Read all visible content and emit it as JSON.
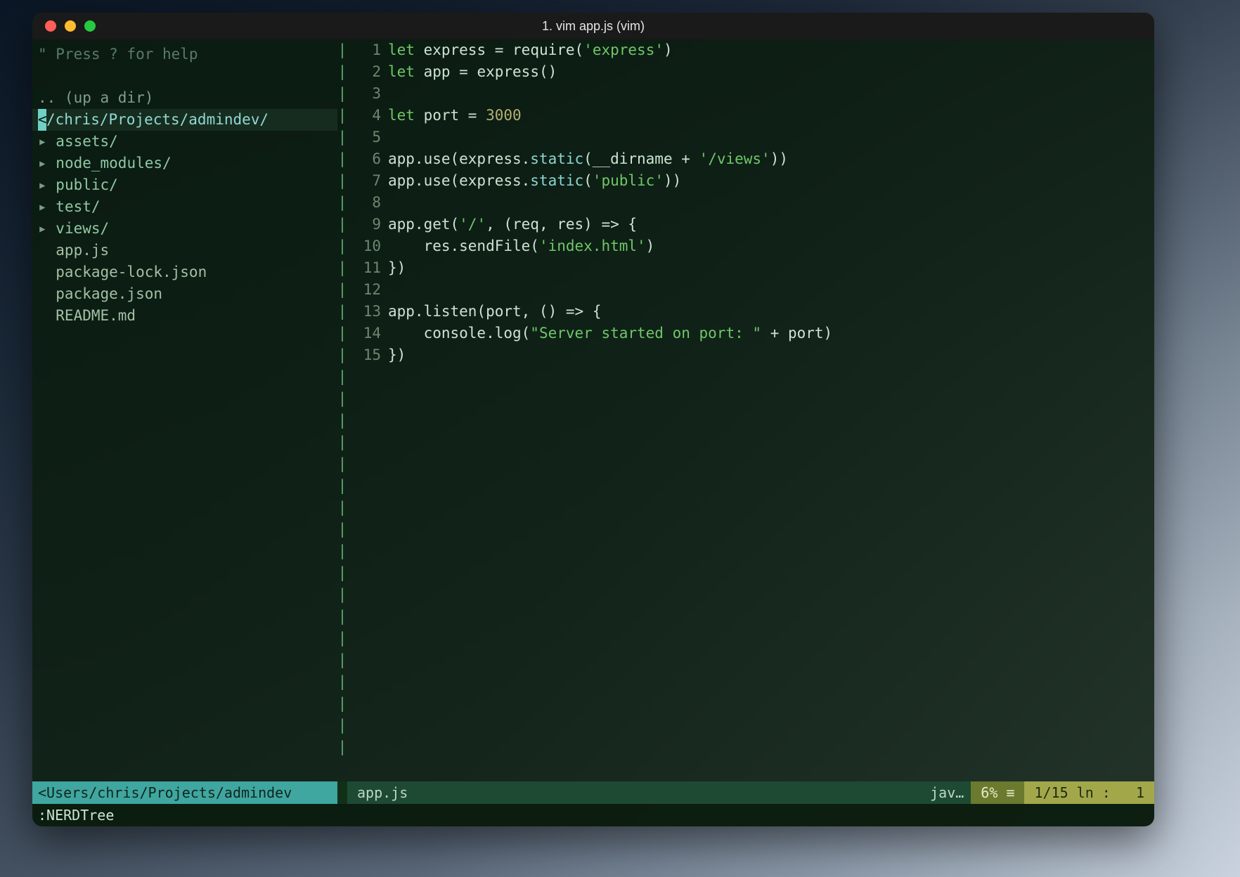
{
  "window": {
    "title": "1. vim app.js (vim)"
  },
  "nerdtree": {
    "help": "\" Press ? for help",
    "updir": ".. (up a dir)",
    "root_cursor": "<",
    "root": "/chris/Projects/admindev/",
    "items": [
      {
        "type": "dir",
        "label": "assets/"
      },
      {
        "type": "dir",
        "label": "node_modules/"
      },
      {
        "type": "dir",
        "label": "public/"
      },
      {
        "type": "dir",
        "label": "test/"
      },
      {
        "type": "dir",
        "label": "views/"
      },
      {
        "type": "file",
        "label": "app.js"
      },
      {
        "type": "file",
        "label": "package-lock.json"
      },
      {
        "type": "file",
        "label": "package.json"
      },
      {
        "type": "file",
        "label": "README.md"
      }
    ]
  },
  "editor": {
    "lines": [
      {
        "n": "1",
        "tokens": [
          [
            "kw",
            "let"
          ],
          [
            "plain",
            " express "
          ],
          [
            "op",
            "="
          ],
          [
            "plain",
            " require("
          ],
          [
            "str",
            "'express'"
          ],
          [
            "plain",
            ")"
          ]
        ]
      },
      {
        "n": "2",
        "tokens": [
          [
            "kw",
            "let"
          ],
          [
            "plain",
            " app "
          ],
          [
            "op",
            "="
          ],
          [
            "plain",
            " express()"
          ]
        ]
      },
      {
        "n": "3",
        "tokens": []
      },
      {
        "n": "4",
        "tokens": [
          [
            "kw",
            "let"
          ],
          [
            "plain",
            " port "
          ],
          [
            "op",
            "="
          ],
          [
            "plain",
            " "
          ],
          [
            "num",
            "3000"
          ]
        ]
      },
      {
        "n": "5",
        "tokens": []
      },
      {
        "n": "6",
        "tokens": [
          [
            "plain",
            "app.use(express."
          ],
          [
            "func",
            "static"
          ],
          [
            "plain",
            "(__dirname "
          ],
          [
            "op",
            "+"
          ],
          [
            "plain",
            " "
          ],
          [
            "str",
            "'/views'"
          ],
          [
            "plain",
            "))"
          ]
        ]
      },
      {
        "n": "7",
        "tokens": [
          [
            "plain",
            "app.use(express."
          ],
          [
            "func",
            "static"
          ],
          [
            "plain",
            "("
          ],
          [
            "str",
            "'public'"
          ],
          [
            "plain",
            "))"
          ]
        ]
      },
      {
        "n": "8",
        "tokens": []
      },
      {
        "n": "9",
        "tokens": [
          [
            "plain",
            "app.get("
          ],
          [
            "str",
            "'/'"
          ],
          [
            "plain",
            ", (req, res) "
          ],
          [
            "fat",
            "=>"
          ],
          [
            "plain",
            " {"
          ]
        ]
      },
      {
        "n": "10",
        "tokens": [
          [
            "plain",
            "    res.sendFile("
          ],
          [
            "str",
            "'index.html'"
          ],
          [
            "plain",
            ")"
          ]
        ]
      },
      {
        "n": "11",
        "tokens": [
          [
            "plain",
            "})"
          ]
        ]
      },
      {
        "n": "12",
        "tokens": []
      },
      {
        "n": "13",
        "tokens": [
          [
            "plain",
            "app.listen(port, () "
          ],
          [
            "fat",
            "=>"
          ],
          [
            "plain",
            " {"
          ]
        ]
      },
      {
        "n": "14",
        "tokens": [
          [
            "plain",
            "    console.log("
          ],
          [
            "str",
            "\"Server started on port: \""
          ],
          [
            "plain",
            " "
          ],
          [
            "op",
            "+"
          ],
          [
            "plain",
            " port)"
          ]
        ]
      },
      {
        "n": "15",
        "tokens": [
          [
            "plain",
            "})"
          ]
        ]
      }
    ]
  },
  "statusbar": {
    "left_path": "<Users/chris/Projects/admindev",
    "filename": "app.js",
    "lang": "jav…",
    "percent": "6% ≡",
    "position": "1/15 ln :   1"
  },
  "cmdline": ":NERDTree"
}
